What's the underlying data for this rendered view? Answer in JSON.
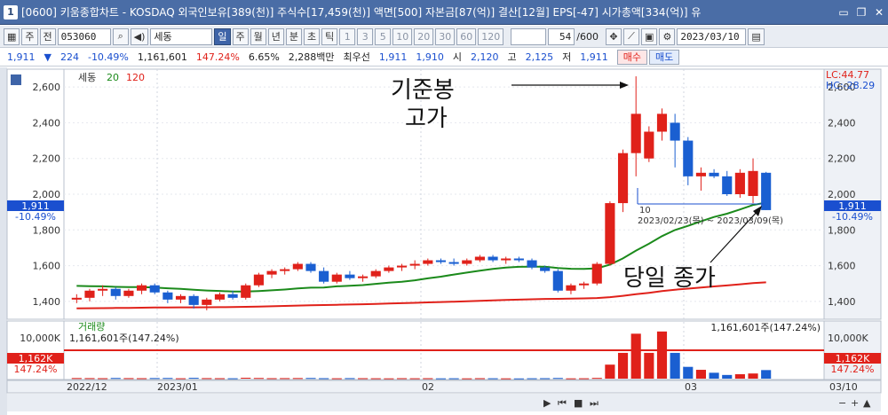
{
  "window": {
    "number": "1",
    "title": "[0600] 키움종합차트 - KOSDAQ 외국인보유[389(천)] 주식수[17,459(천)] 액면[500] 자본금[87(억)] 결산[12월] EPS[-47] 시가총액[334(억)] 유"
  },
  "toolbar": {
    "market1": "주",
    "market2": "전",
    "code": "053060",
    "stock_name": "세동",
    "periods": [
      "일",
      "주",
      "월",
      "년",
      "분",
      "초",
      "틱"
    ],
    "active_period": "일",
    "intervals": [
      "1",
      "3",
      "5",
      "10",
      "20",
      "30",
      "60",
      "120"
    ],
    "count": "54",
    "count_total": "/600",
    "date": "2023/03/10"
  },
  "quote": {
    "price": "1,911",
    "arrow": "▼",
    "change": "224",
    "change_pct": "-10.49%",
    "volume": "1,161,601",
    "volume_pct": "147.24%",
    "turnover": "6.65%",
    "amount": "2,288백만",
    "priority_label": "최우선",
    "bid1": "1,911",
    "bid2": "1,910",
    "open_label": "시",
    "open": "2,120",
    "high_label": "고",
    "high": "2,125",
    "low_label": "저",
    "low": "1,911",
    "buy_button": "매수",
    "sell_button": "매도"
  },
  "chart": {
    "legend_name": "세동",
    "ma_labels": [
      "20",
      "120"
    ],
    "lc": "LC:44.77",
    "hc": "HC:-28.29",
    "price_ticks": [
      "2,600",
      "2,400",
      "2,200",
      "2,000",
      "1,800",
      "1,600",
      "1,400"
    ],
    "current_price_tag": "1,911",
    "current_pct_tag": "-10.49%",
    "min_label": "10",
    "date_range": "2023/02/23(목) ~ 2023/03/09(목)",
    "annotation_high": "기준봉\n고가",
    "annotation_close": "당일 종가",
    "volume_title": "거래량",
    "volume_info_left": "1,161,601주(147.24%)",
    "volume_info_right": "1,161,601주(147.24%)",
    "volume_tick": "10,000K",
    "volume_tag": "1,162K",
    "volume_pct_tag": "147.24%",
    "x_labels": [
      "2022/12",
      "2023/01",
      "02",
      "03"
    ],
    "x_right": "03/10"
  },
  "chart_data": {
    "type": "candlestick",
    "yrange": [
      1300,
      2700
    ],
    "ohlc": [
      [
        1410,
        1440,
        1390,
        1420
      ],
      [
        1420,
        1470,
        1400,
        1460
      ],
      [
        1460,
        1490,
        1430,
        1470
      ],
      [
        1470,
        1480,
        1410,
        1430
      ],
      [
        1430,
        1470,
        1420,
        1460
      ],
      [
        1460,
        1500,
        1440,
        1490
      ],
      [
        1490,
        1500,
        1440,
        1450
      ],
      [
        1450,
        1460,
        1390,
        1410
      ],
      [
        1410,
        1440,
        1390,
        1430
      ],
      [
        1430,
        1440,
        1360,
        1380
      ],
      [
        1380,
        1420,
        1350,
        1410
      ],
      [
        1410,
        1450,
        1400,
        1440
      ],
      [
        1440,
        1460,
        1410,
        1420
      ],
      [
        1420,
        1500,
        1410,
        1490
      ],
      [
        1490,
        1560,
        1480,
        1550
      ],
      [
        1550,
        1580,
        1530,
        1570
      ],
      [
        1570,
        1590,
        1550,
        1580
      ],
      [
        1580,
        1620,
        1570,
        1610
      ],
      [
        1610,
        1620,
        1560,
        1570
      ],
      [
        1570,
        1590,
        1500,
        1510
      ],
      [
        1510,
        1560,
        1500,
        1550
      ],
      [
        1550,
        1570,
        1520,
        1530
      ],
      [
        1530,
        1550,
        1510,
        1540
      ],
      [
        1540,
        1580,
        1530,
        1570
      ],
      [
        1570,
        1600,
        1560,
        1590
      ],
      [
        1590,
        1610,
        1570,
        1600
      ],
      [
        1600,
        1630,
        1580,
        1610
      ],
      [
        1610,
        1640,
        1600,
        1630
      ],
      [
        1630,
        1640,
        1610,
        1620
      ],
      [
        1620,
        1640,
        1600,
        1610
      ],
      [
        1610,
        1640,
        1600,
        1630
      ],
      [
        1630,
        1660,
        1620,
        1650
      ],
      [
        1650,
        1660,
        1620,
        1630
      ],
      [
        1630,
        1650,
        1610,
        1640
      ],
      [
        1640,
        1650,
        1620,
        1630
      ],
      [
        1630,
        1640,
        1580,
        1590
      ],
      [
        1590,
        1600,
        1560,
        1570
      ],
      [
        1570,
        1580,
        1450,
        1460
      ],
      [
        1460,
        1500,
        1440,
        1490
      ],
      [
        1490,
        1510,
        1470,
        1500
      ],
      [
        1500,
        1620,
        1490,
        1610
      ],
      [
        1610,
        1960,
        1600,
        1950
      ],
      [
        1950,
        2250,
        1900,
        2230
      ],
      [
        2230,
        2660,
        2100,
        2450
      ],
      [
        2200,
        2380,
        2180,
        2350
      ],
      [
        2350,
        2480,
        2300,
        2450
      ],
      [
        2400,
        2450,
        2150,
        2300
      ],
      [
        2300,
        2320,
        2050,
        2100
      ],
      [
        2100,
        2150,
        2020,
        2120
      ],
      [
        2120,
        2140,
        2090,
        2100
      ],
      [
        2100,
        2130,
        1990,
        2000
      ],
      [
        2000,
        2140,
        1980,
        2120
      ],
      [
        1990,
        2200,
        1950,
        2130
      ],
      [
        2120,
        2125,
        1911,
        1911
      ]
    ],
    "volume_k": [
      80,
      70,
      60,
      90,
      70,
      60,
      80,
      90,
      50,
      110,
      70,
      60,
      50,
      120,
      90,
      60,
      70,
      80,
      90,
      60,
      50,
      70,
      60,
      50,
      40,
      60,
      50,
      60,
      40,
      50,
      40,
      60,
      50,
      40,
      30,
      50,
      60,
      90,
      40,
      50,
      100,
      1900,
      3500,
      6100,
      3500,
      6400,
      3500,
      1600,
      1200,
      800,
      500,
      600,
      700,
      1162
    ],
    "ma20_start": 1490,
    "ma120_start": 1360
  }
}
